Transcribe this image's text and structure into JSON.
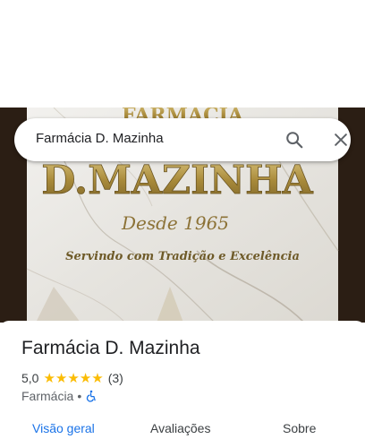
{
  "search": {
    "query": "Farmácia D. Mazinha",
    "search_icon": "search-icon",
    "close_icon": "close-icon"
  },
  "photo": {
    "sign_top_partial": "FARMÁCIA",
    "sign_name": "D.MAZINHA",
    "sign_since": "Desde 1965",
    "sign_tagline": "Servindo com Tradição e Excelência"
  },
  "place": {
    "name": "Farmácia D. Mazinha",
    "rating": "5,0",
    "stars": [
      "★",
      "★",
      "★",
      "★",
      "★"
    ],
    "review_count": "(3)",
    "category": "Farmácia",
    "separator": "•",
    "accessibility_icon": "wheelchair-icon"
  },
  "tabs": [
    {
      "label": "Visão geral",
      "active": true
    },
    {
      "label": "Avaliações",
      "active": false
    },
    {
      "label": "Sobre",
      "active": false
    }
  ],
  "colors": {
    "accent": "#1a73e8",
    "star": "#fbbc04",
    "sign_gold": "#b8973f"
  }
}
